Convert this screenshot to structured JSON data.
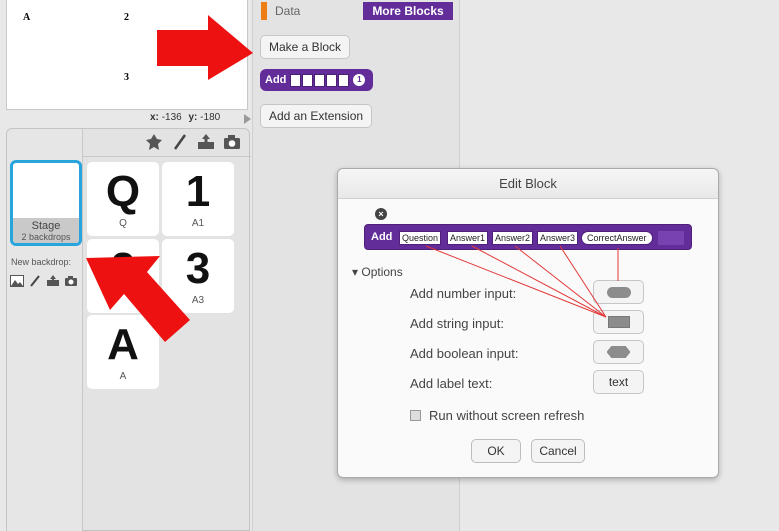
{
  "stage": {
    "labels": [
      "A",
      "2",
      "3"
    ],
    "x_label": "x:",
    "x_value": "-136",
    "y_label": "y:",
    "y_value": "-180"
  },
  "stage_panel": {
    "thumb_title": "Stage",
    "thumb_subtitle": "2 backdrops",
    "new_backdrop": "New backdrop:"
  },
  "sprites": [
    {
      "glyph": "Q",
      "name": "Q"
    },
    {
      "glyph": "1",
      "name": "A1"
    },
    {
      "glyph": "2",
      "name": ""
    },
    {
      "glyph": "3",
      "name": "A3"
    },
    {
      "glyph": "A",
      "name": "A"
    }
  ],
  "palette": {
    "category_data": "Data",
    "category_more": "More Blocks",
    "make_block": "Make a Block",
    "add_extension": "Add an Extension",
    "mini_block_label": "Add",
    "mini_block_badge": "1"
  },
  "dialog": {
    "title": "Edit Block",
    "close": "×",
    "block_label": "Add",
    "params": [
      "Question",
      "Answer1",
      "Answer2",
      "Answer3",
      "CorrectAnswer"
    ],
    "options_label": "Options",
    "number_input": "Add number input:",
    "string_input": "Add string input:",
    "boolean_input": "Add boolean input:",
    "label_text": "Add label text:",
    "label_button": "text",
    "run_without_refresh": "Run without screen refresh",
    "ok": "OK",
    "cancel": "Cancel"
  },
  "colors": {
    "more_blocks": "#632d99",
    "data_category": "#ee7d16",
    "selected_border": "#29a5de",
    "arrow": "#ee1111",
    "connector_line": "#e23a3a"
  }
}
